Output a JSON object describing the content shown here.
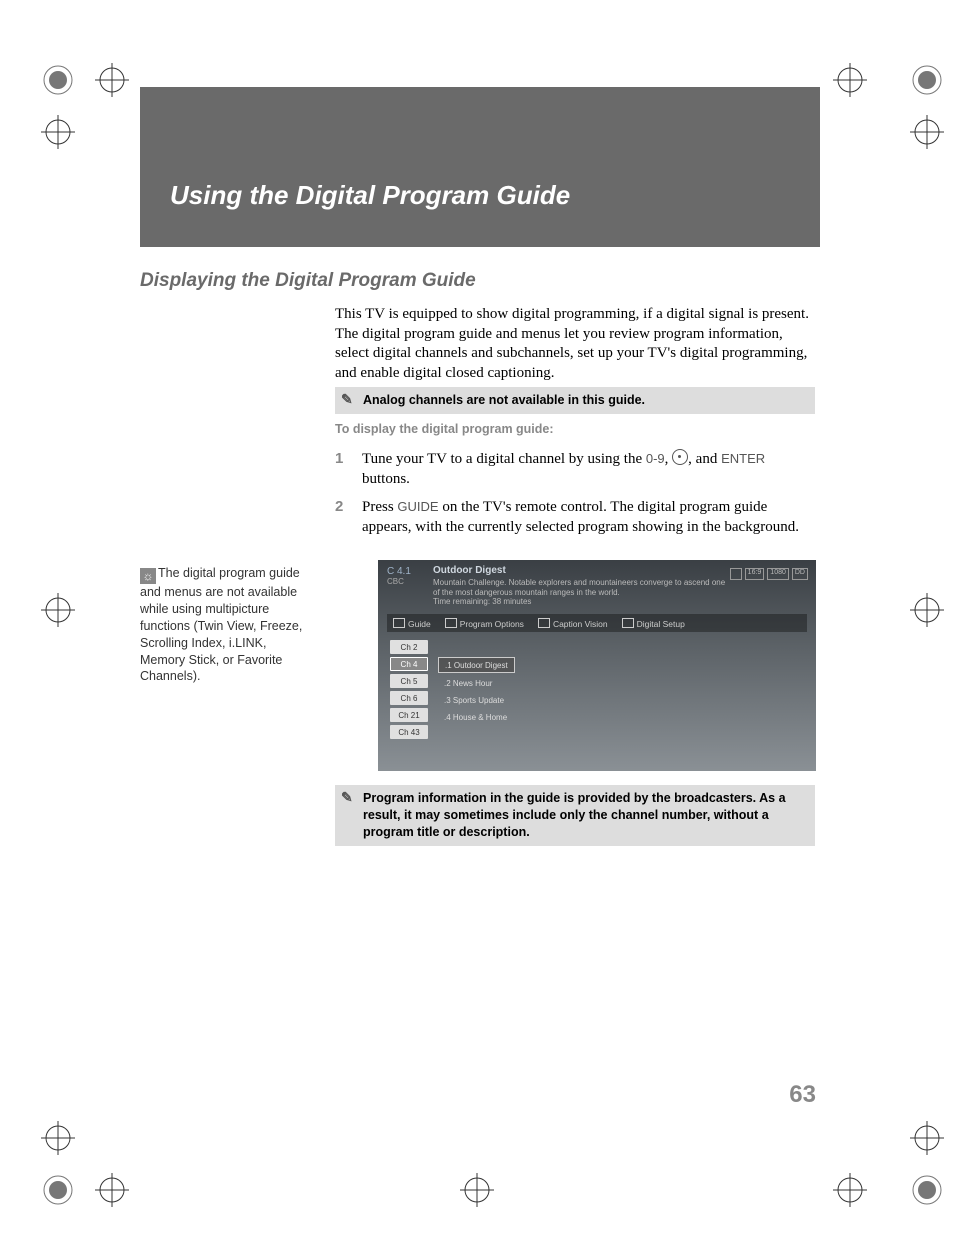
{
  "chapter_title": "Using the Digital Program Guide",
  "section_title": "Displaying the Digital Program Guide",
  "intro": "This TV is equipped to show digital programming, if a digital signal is present. The digital program guide and menus let you review program information, select digital channels and subchannels, set up your TV's digital programming, and enable digital closed captioning.",
  "note1": "Analog channels are not available in this guide.",
  "instruction_lead": "To display the digital program guide:",
  "step1_num": "1",
  "step1_pre": "Tune your TV to a digital channel by using the ",
  "step1_btn1": "0-9",
  "step1_mid": ", ",
  "step1_post": ", and ",
  "step1_btn2": "ENTER",
  "step1_end": " buttons.",
  "step2_num": "2",
  "step2_pre": "Press ",
  "step2_btn": "GUIDE",
  "step2_post": " on the TV's remote control. The digital program guide appears, with the currently selected program showing in the background.",
  "sidebar_tip": "The digital program guide and menus are not available while using multipicture functions (Twin View, Freeze, Scrolling Index, i.LINK, Memory Stick, or Favorite Channels).",
  "note2": "Program information in the guide is provided by the broadcasters. As a result, it may sometimes include only the channel number, without a program title or description.",
  "page_number": "63",
  "screenshot": {
    "channel_num": "C 4.1",
    "channel_name": "CBC",
    "program_title": "Outdoor Digest",
    "program_desc": "Mountain Challenge. Notable explorers and mountaineers converge to ascend one of the most dangerous mountain ranges in the world.",
    "time_remaining": "Time remaining: 38 minutes",
    "badges": [
      "16:9",
      "1080",
      "DD"
    ],
    "tabs": [
      "Guide",
      "Program Options",
      "Caption Vision",
      "Digital Setup"
    ],
    "channels": [
      "Ch 2",
      "Ch 4",
      "Ch 5",
      "Ch 6",
      "Ch 21",
      "Ch 43"
    ],
    "selected_channel_index": 1,
    "subchannels": [
      ".1 Outdoor Digest",
      ".2 News Hour",
      ".3 Sports Update",
      ".4 House & Home"
    ],
    "selected_sub_index": 0
  }
}
